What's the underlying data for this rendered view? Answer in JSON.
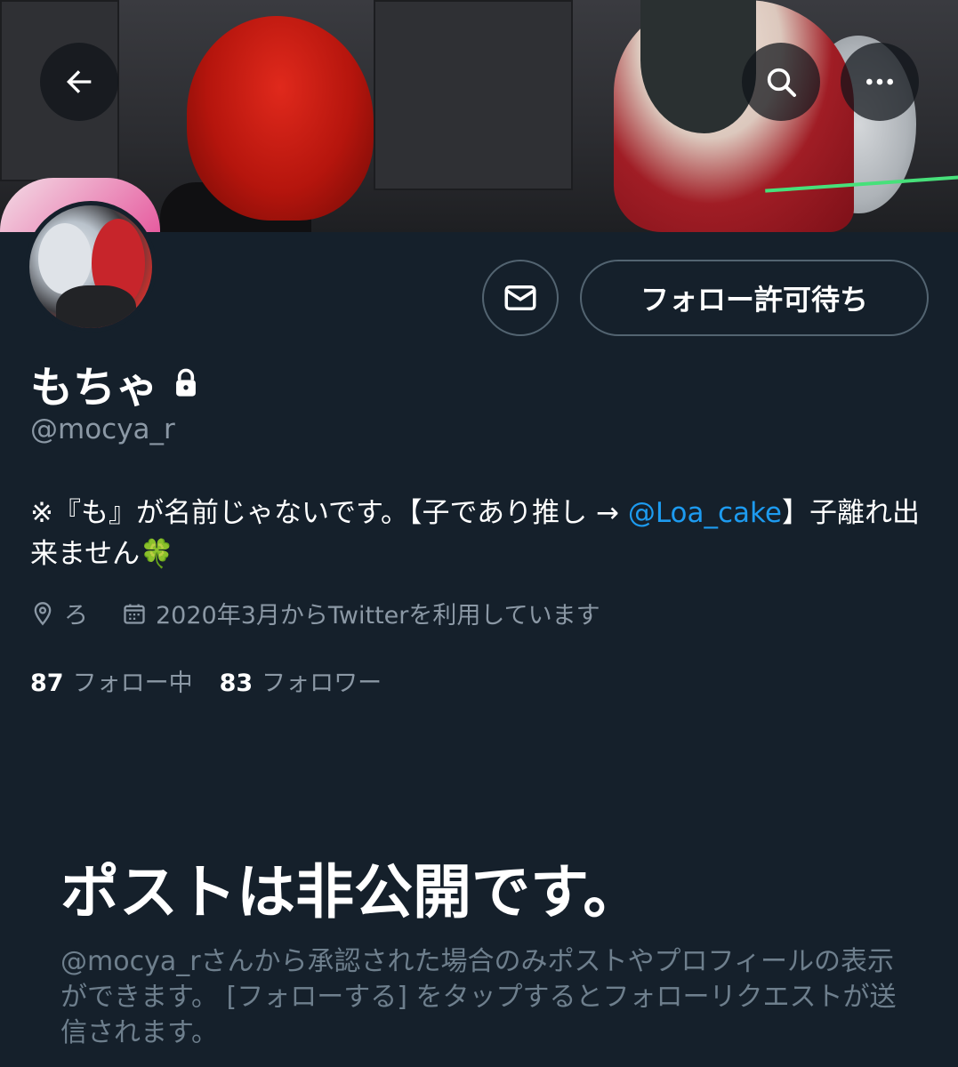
{
  "header": {
    "back_icon": "arrow-left-icon",
    "search_icon": "search-icon",
    "more_icon": "more-dots-icon"
  },
  "profile": {
    "display_name": "もちゃ",
    "lock_icon": "lock-icon",
    "handle": "@mocya_r",
    "follow_button_label": "フォロー許可待ち",
    "mail_icon": "mail-icon",
    "bio_text": "※『も』が名前じゃないです。【子であり推し → ",
    "bio_mention": "@Loa_cake",
    "bio_text_after": "】子離れ出来ません🍀",
    "location": "ろ",
    "joined": "2020年3月からTwitterを利用しています",
    "following_count": "87",
    "following_label": "フォロー中",
    "followers_count": "83",
    "followers_label": "フォロワー"
  },
  "private_notice": {
    "title": "ポストは非公開です。",
    "description": "@mocya_rさんから承認された場合のみポストやプロフィールの表示ができます。 [フォローする] をタップするとフォローリクエストが送信されます。"
  },
  "colors": {
    "background": "#15202b",
    "link": "#1d9bf0",
    "secondary_text": "#8b98a5",
    "border": "#536471"
  }
}
